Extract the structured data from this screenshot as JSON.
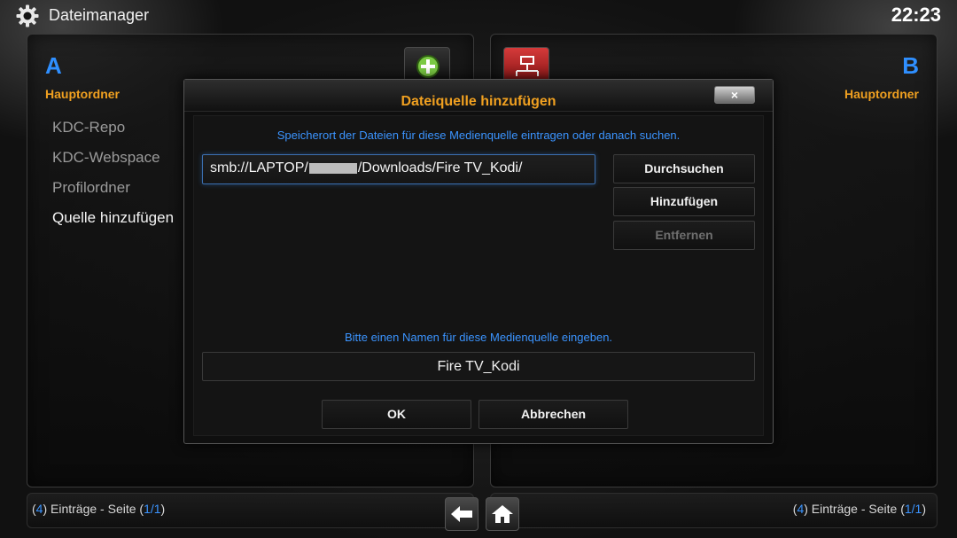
{
  "header": {
    "title": "Dateimanager",
    "clock": "22:23",
    "icon": "gear-icon"
  },
  "left_panel": {
    "letter": "A",
    "heading": "Hauptordner",
    "items": [
      {
        "label": "KDC-Repo"
      },
      {
        "label": "KDC-Webspace"
      },
      {
        "label": "Profilordner"
      },
      {
        "label": "Quelle hinzufügen"
      }
    ],
    "icon": "add-source-icon"
  },
  "right_panel": {
    "letter": "B",
    "heading": "Hauptordner",
    "icon": "network-icon"
  },
  "footer_left": {
    "count": "4",
    "text_mid": ") Einträge - Seite (",
    "page": "1/1",
    "text_end": ")",
    "open": "("
  },
  "footer_right": {
    "count": "4",
    "text_mid": ") Einträge - Seite (",
    "page": "1/1",
    "text_end": ")",
    "open": "("
  },
  "dialog": {
    "title": "Dateiquelle hinzufügen",
    "close_label": "×",
    "path_hint": "Speicherort der Dateien für diese Medienquelle eintragen oder danach suchen.",
    "path_prefix": "smb://LAPTOP/",
    "path_suffix": "/Downloads/Fire TV_Kodi/",
    "browse_label": "Durchsuchen",
    "add_label": "Hinzufügen",
    "remove_label": "Entfernen",
    "name_hint": "Bitte einen Namen für diese Medienquelle eingeben.",
    "name_value": "Fire TV_Kodi",
    "ok_label": "OK",
    "cancel_label": "Abbrechen"
  },
  "colors": {
    "accent_blue": "#3b94ff",
    "heading_orange": "#f0a020"
  }
}
